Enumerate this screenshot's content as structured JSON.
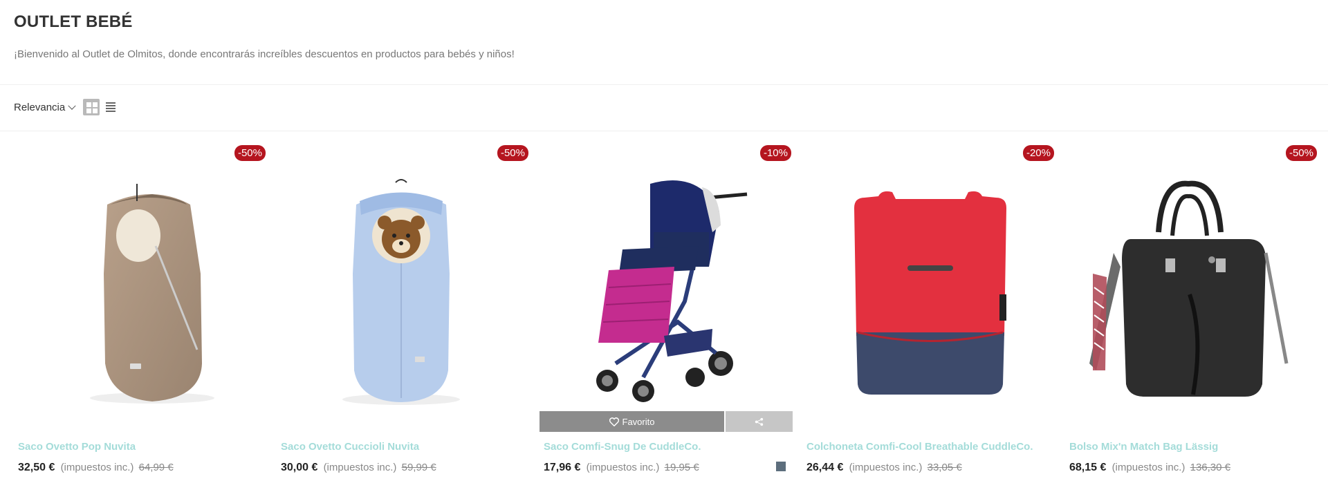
{
  "page": {
    "title": "OUTLET BEBÉ",
    "description": "¡Bienvenido al Outlet de Olmitos, donde encontrarás increíbles descuentos en productos para bebés y niños!"
  },
  "toolbar": {
    "sort_label": "Relevancia",
    "grid_view_icon": "grid-icon",
    "list_view_icon": "list-icon"
  },
  "colors": {
    "badge": "#b5151f",
    "product_name": "#a4dcd9",
    "swatch": "#5d6e7d"
  },
  "products": [
    {
      "name": "Saco Ovetto Pop Nuvita",
      "badge": "-50%",
      "price": "32,50 €",
      "tax": "(impuestos inc.)",
      "old_price": "64,99 €",
      "image": "beige-footmuff"
    },
    {
      "name": "Saco Ovetto Cuccioli Nuvita",
      "badge": "-50%",
      "price": "30,00 €",
      "tax": "(impuestos inc.)",
      "old_price": "59,99 €",
      "image": "light-blue-bear-footmuff"
    },
    {
      "name": "Saco Comfi-Snug De CuddleCo.",
      "badge": "-10%",
      "price": "17,96 €",
      "tax": "(impuestos inc.)",
      "old_price": "19,95 €",
      "image": "stroller-with-pink-footmuff",
      "favorite_label": "Favorito",
      "favorite_icon": "heart-icon",
      "share_icon": "share-icon",
      "swatch_color": "#5d6e7d"
    },
    {
      "name": "Colchoneta Comfi-Cool Breathable CuddleCo.",
      "badge": "-20%",
      "price": "26,44 €",
      "tax": "(impuestos inc.)",
      "old_price": "33,05 €",
      "image": "red-stroller-liner"
    },
    {
      "name": "Bolso Mix'n Match Bag Lässig",
      "badge": "-50%",
      "price": "68,15 €",
      "tax": "(impuestos inc.)",
      "old_price": "136,30 €",
      "image": "black-diaper-bag"
    }
  ]
}
